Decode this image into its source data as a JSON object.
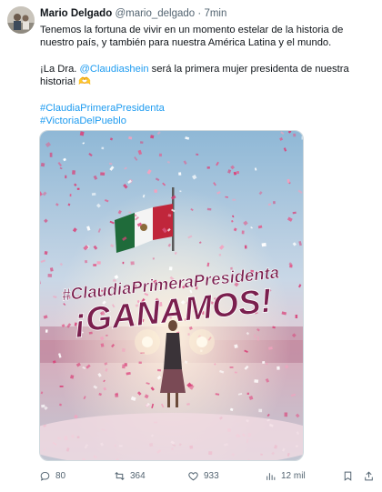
{
  "author": {
    "name": "Mario Delgado",
    "handle": "@mario_delgado",
    "separator": "·",
    "time": "7min"
  },
  "tweet": {
    "line1": "Tenemos la fortuna de vivir en un momento estelar de la historia de nuestro país, y también para nuestra América Latina y el mundo.",
    "line2_prefix": "¡La Dra. ",
    "line2_mention": "@Claudiashein",
    "line2_suffix": " será la primera mujer presidenta de nuestra historia! 🫶",
    "hashtag1": "#ClaudiaPrimeraPresidenta",
    "hashtag2": "#VictoriaDelPueblo"
  },
  "media": {
    "banner_line1": "#ClaudiaPrimeraPresidenta",
    "banner_line2": "¡GANAMOS!"
  },
  "actions": {
    "replies": "80",
    "retweets": "364",
    "likes": "933",
    "views": "12 mil"
  },
  "colors": {
    "link": "#1d9bf0",
    "muted": "#536471",
    "banner": "#7a1f4e",
    "confetti": "#e0608f"
  }
}
